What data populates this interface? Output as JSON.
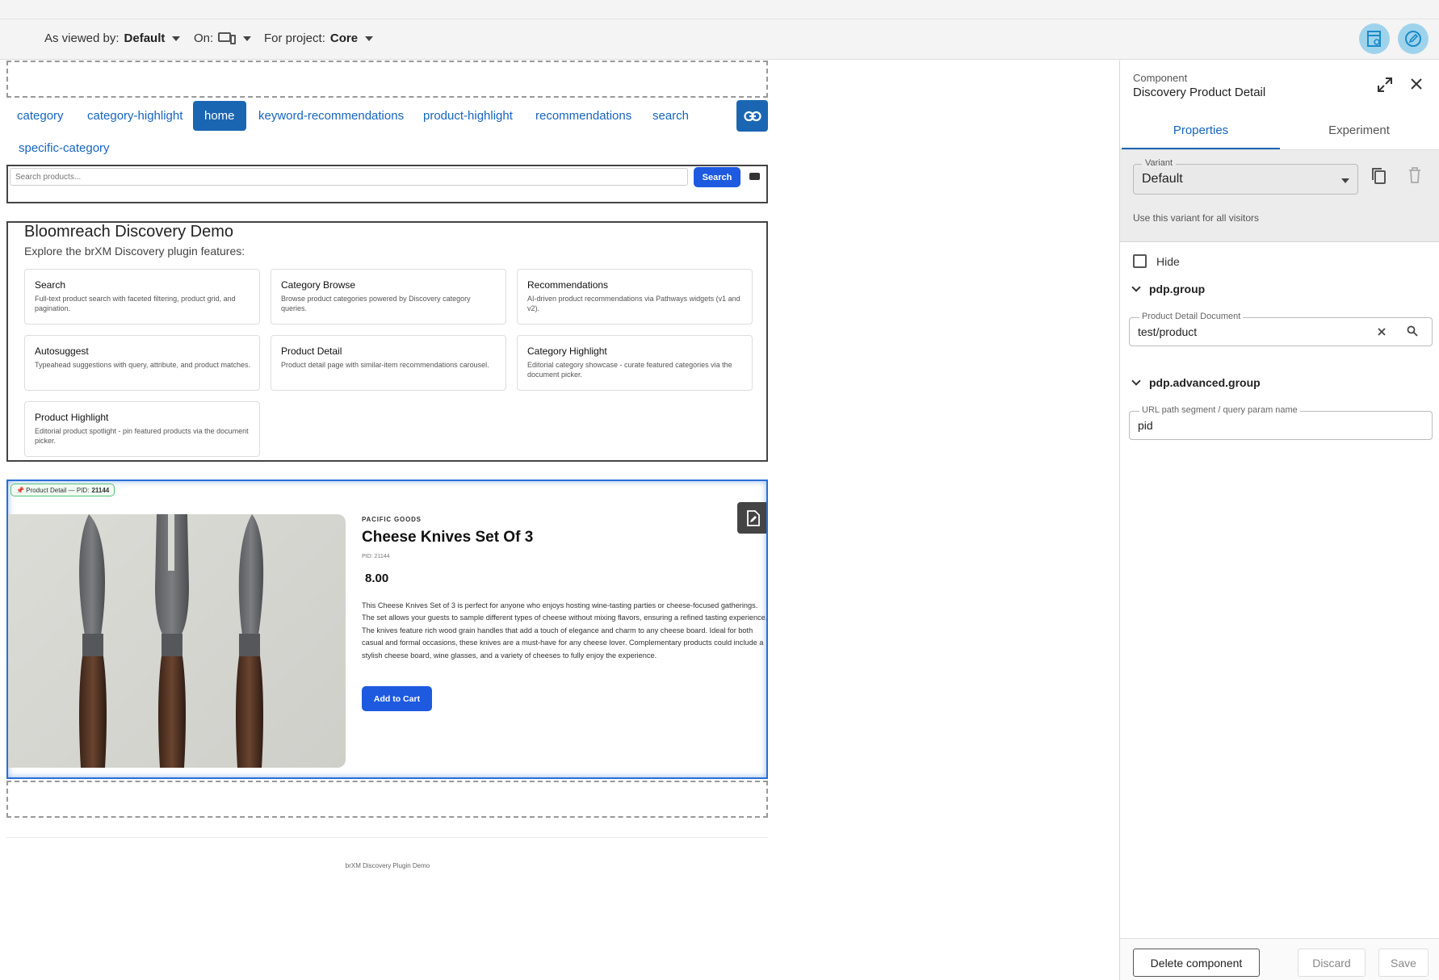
{
  "toolbar": {
    "viewed_by_label": "As viewed by:",
    "viewed_by_value": "Default",
    "on_label": "On:",
    "device_icon": "desktop-mobile-icon",
    "project_label": "For project:",
    "project_value": "Core",
    "right_icons": [
      "page-preview-icon",
      "edit-mode-icon"
    ],
    "accent_color": "#9fd3ec"
  },
  "nav": {
    "links": [
      {
        "label": "category",
        "active": false
      },
      {
        "label": "category-highlight",
        "active": false
      },
      {
        "label": "home",
        "active": true
      },
      {
        "label": "keyword-recommendations",
        "active": false
      },
      {
        "label": "product-highlight",
        "active": false
      },
      {
        "label": "recommendations",
        "active": false
      },
      {
        "label": "search",
        "active": false
      },
      {
        "label": "specific-category",
        "active": false
      }
    ],
    "link_button_icon": "link-icon"
  },
  "search": {
    "placeholder": "Search products...",
    "button_label": "Search",
    "camera_icon": "camera-icon"
  },
  "demo": {
    "title": "Bloomreach Discovery Demo",
    "subtitle": "Explore the brXM Discovery plugin features:",
    "cards": [
      {
        "title": "Search",
        "desc": "Full-text product search with faceted filtering, product grid, and pagination."
      },
      {
        "title": "Category Browse",
        "desc": "Browse product categories powered by Discovery category queries."
      },
      {
        "title": "Recommendations",
        "desc": "AI-driven product recommendations via Pathways widgets (v1 and v2)."
      },
      {
        "title": "Autosuggest",
        "desc": "Typeahead suggestions with query, attribute, and product matches."
      },
      {
        "title": "Product Detail",
        "desc": "Product detail page with similar-item recommendations carousel."
      },
      {
        "title": "Category Highlight",
        "desc": "Editorial category showcase - curate featured categories via the document picker."
      },
      {
        "title": "Product Highlight",
        "desc": "Editorial product spotlight - pin featured products via the document picker."
      }
    ]
  },
  "product": {
    "badge_prefix": "📌 Product Detail — PID:",
    "badge_pid": "21144",
    "brand": "PACIFIC GOODS",
    "name": "Cheese Knives Set Of 3",
    "pid_line": "PID: 21144",
    "price": "8.00",
    "description": "This Cheese Knives Set of 3 is perfect for anyone who enjoys hosting wine-tasting parties or cheese-focused gatherings. The set allows your guests to sample different types of cheese without mixing flavors, ensuring a refined tasting experience. The knives feature rich wood grain handles that add a touch of elegance and charm to any cheese board. Ideal for both casual and formal occasions, these knives are a must-have for any cheese lover. Complementary products could include a stylish cheese board, wine glasses, and a variety of cheeses to fully enjoy the experience.",
    "add_to_cart": "Add to Cart",
    "edit_doc_icon": "edit-document-icon"
  },
  "footer": {
    "text": "brXM Discovery Plugin Demo"
  },
  "panel": {
    "type_label": "Component",
    "name": "Discovery Product Detail",
    "tabs": [
      "Properties",
      "Experiment"
    ],
    "variant_label": "Variant",
    "variant_value": "Default",
    "variant_hint": "Use this variant for all visitors",
    "hide_label": "Hide",
    "group1": "pdp.group",
    "doc_field_label": "Product Detail Document",
    "doc_field_value": "test/product",
    "group2": "pdp.advanced.group",
    "param_field_label": "URL path segment / query param name",
    "param_field_value": "pid",
    "delete_label": "Delete component",
    "discard_label": "Discard",
    "save_label": "Save"
  }
}
